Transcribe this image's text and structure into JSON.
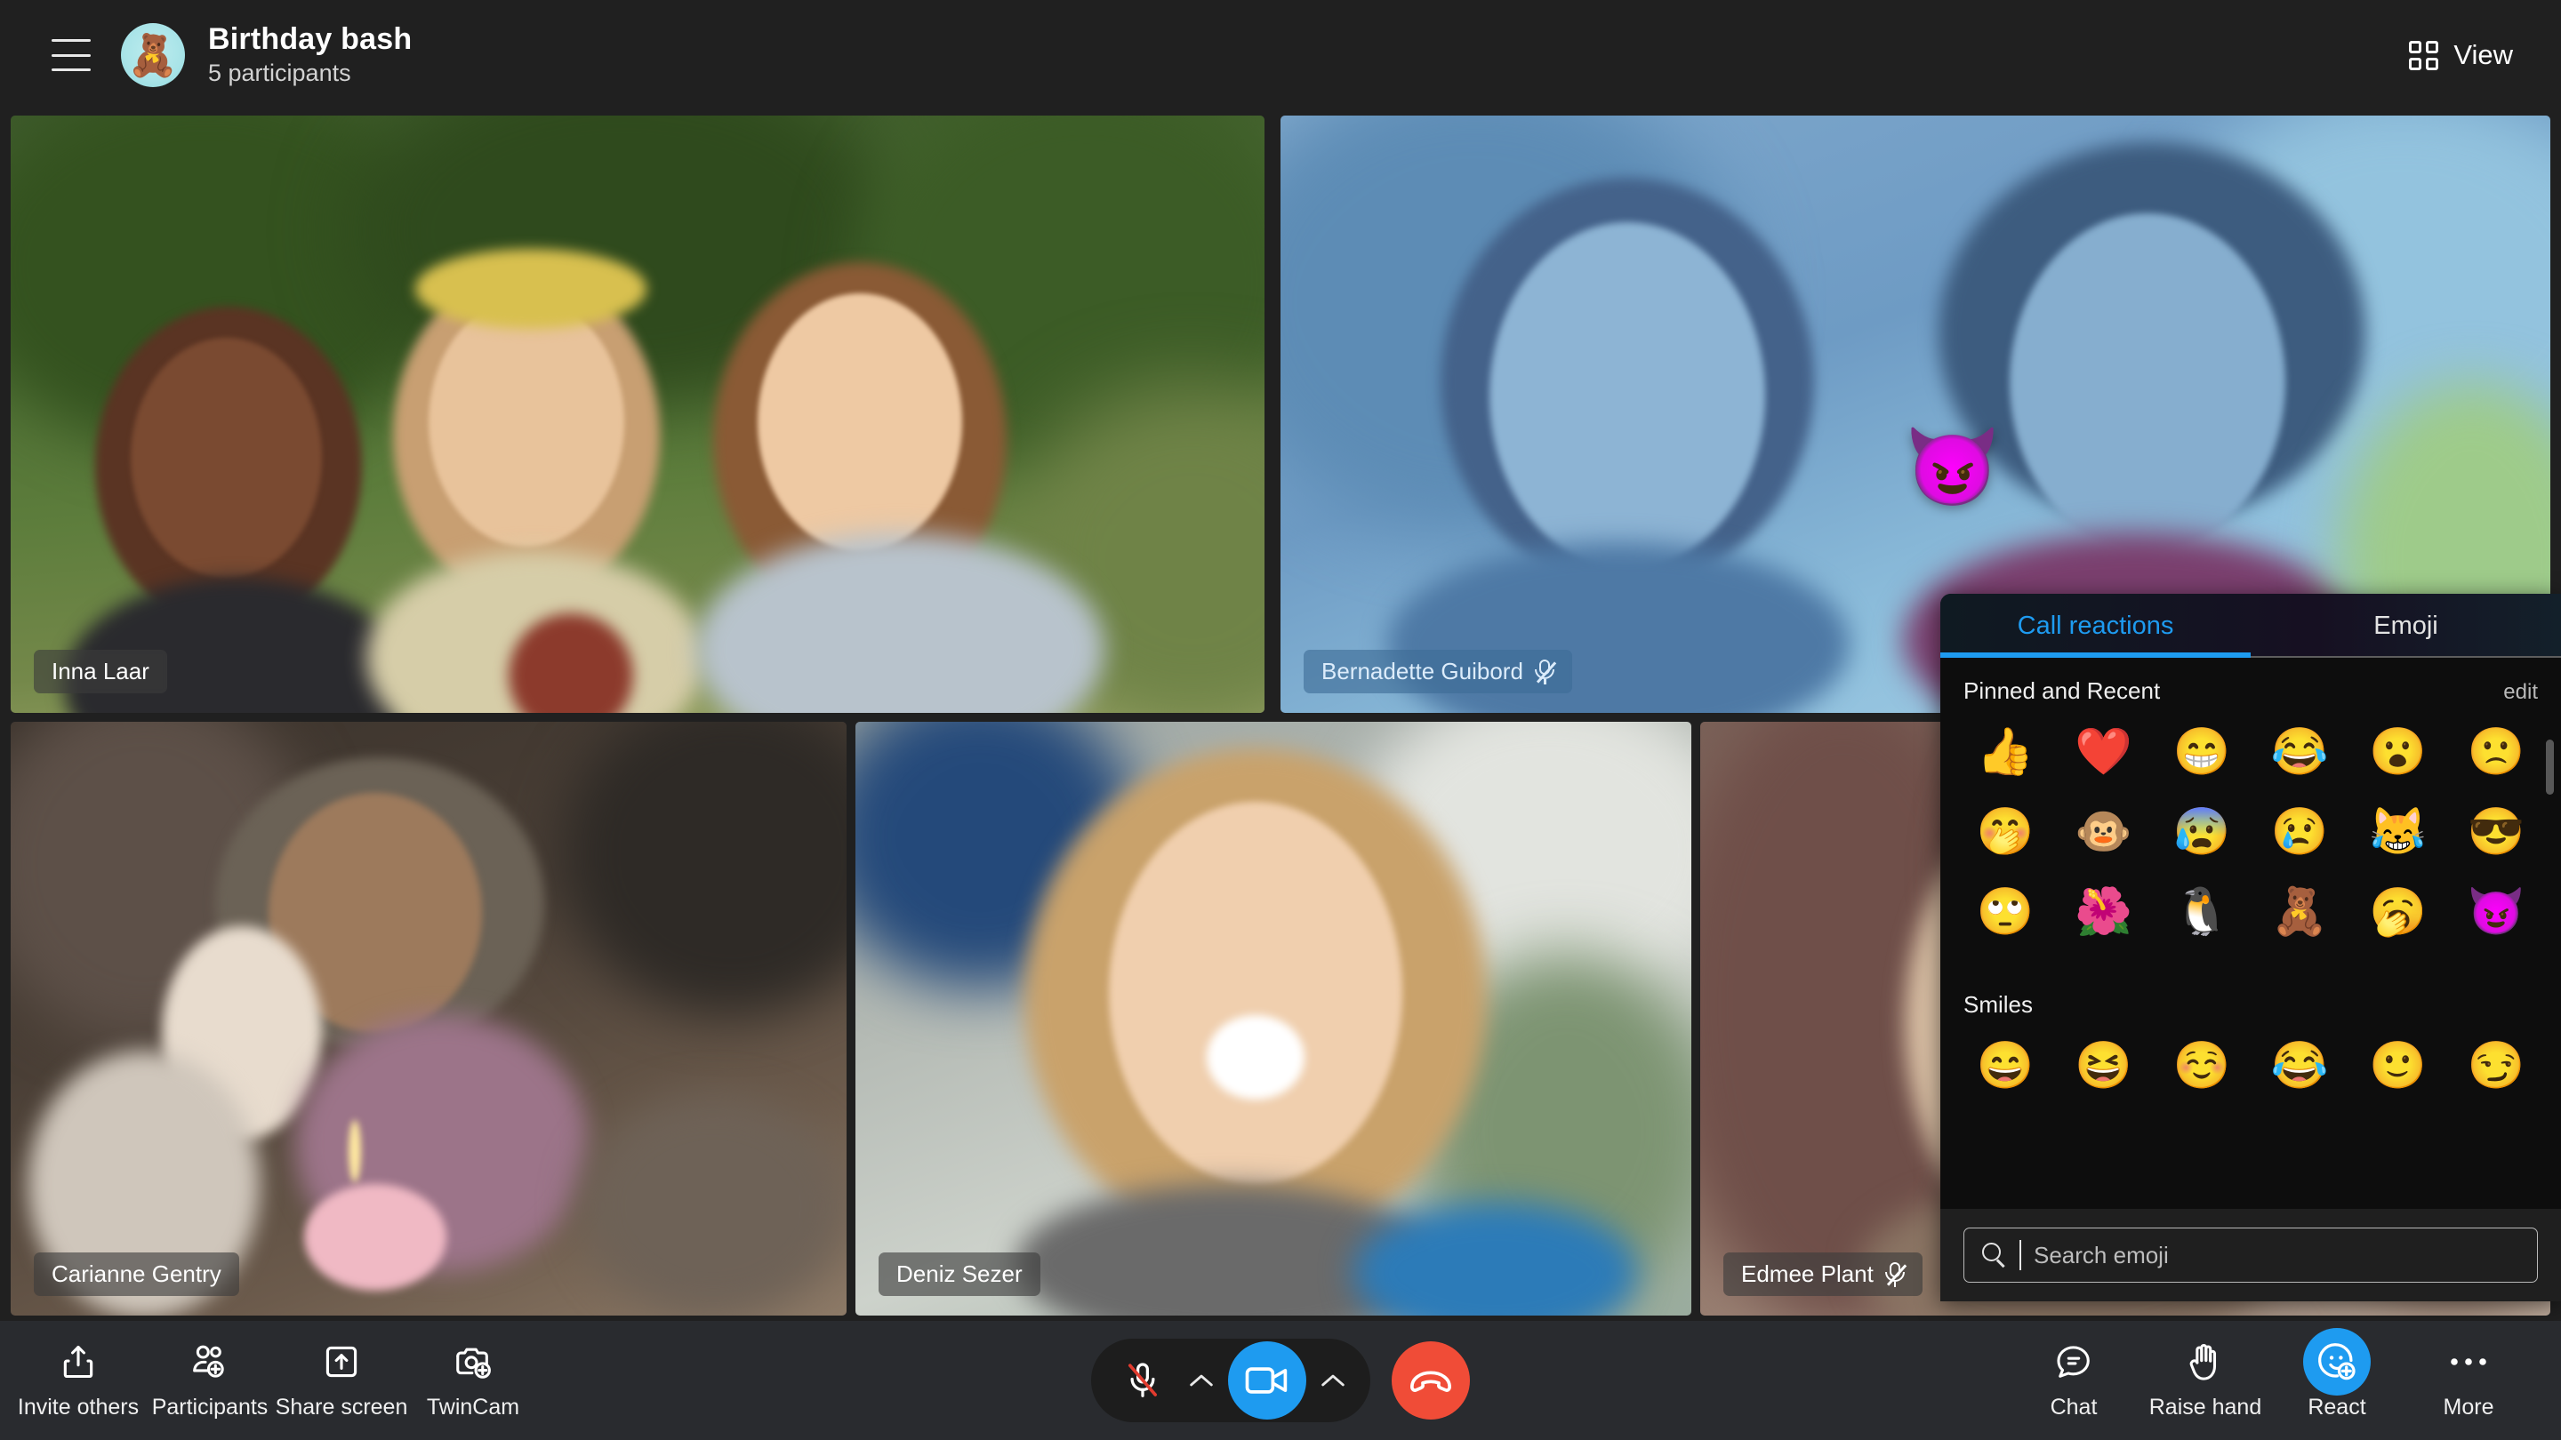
{
  "header": {
    "menu_icon": "hamburger-menu-icon",
    "avatar_emoji": "🧸",
    "title": "Birthday bash",
    "subtitle": "5 participants",
    "view_label": "View",
    "view_icon": "grid-view-icon"
  },
  "colors": {
    "accent_blue": "#1e9bf0",
    "end_call_red": "#f04c37",
    "toolbar_bg": "#292b2f",
    "header_bg": "#202020",
    "panel_bg": "#0d0d0d",
    "mute_slash_red": "#e23b2e"
  },
  "tiles": [
    {
      "name": "Inna Laar",
      "muted": false,
      "tag_style": "dark"
    },
    {
      "name": "Bernadette Guibord",
      "muted": true,
      "tag_style": "blue"
    },
    {
      "name": "Carianne Gentry",
      "muted": false,
      "tag_style": "dark"
    },
    {
      "name": "Deniz Sezer",
      "muted": false,
      "tag_style": "dark"
    },
    {
      "name": "Edmee Plant",
      "muted": true,
      "tag_style": "dark"
    }
  ],
  "floating_reaction": {
    "emoji": "😈",
    "icon_name": "smiling-face-with-horns-reaction"
  },
  "react_panel": {
    "tabs": [
      {
        "label": "Call reactions",
        "active": true
      },
      {
        "label": "Emoji",
        "active": false
      }
    ],
    "sections": [
      {
        "title": "Pinned and Recent",
        "edit_label": "edit",
        "emojis": [
          {
            "glyph": "👍",
            "name": "thumbs-up-emoji"
          },
          {
            "glyph": "❤️",
            "name": "red-heart-emoji"
          },
          {
            "glyph": "😁",
            "name": "grinning-face-emoji"
          },
          {
            "glyph": "😂",
            "name": "face-with-tears-of-joy-emoji"
          },
          {
            "glyph": "😮",
            "name": "surprised-face-emoji"
          },
          {
            "glyph": "🙁",
            "name": "slightly-frowning-face-emoji"
          },
          {
            "glyph": "🤭",
            "name": "face-with-hand-over-mouth-emoji"
          },
          {
            "glyph": "🐵",
            "name": "monkey-emoji"
          },
          {
            "glyph": "😰",
            "name": "anxious-face-with-sweat-emoji"
          },
          {
            "glyph": "😢",
            "name": "crying-face-emoji"
          },
          {
            "glyph": "😹",
            "name": "laughing-with-tears-emoji"
          },
          {
            "glyph": "😎",
            "name": "smiling-face-with-sunglasses-emoji"
          },
          {
            "glyph": "🙄",
            "name": "face-with-rolling-eyes-emoji"
          },
          {
            "glyph": "🌺",
            "name": "flower-emoji"
          },
          {
            "glyph": "🐧",
            "name": "penguin-emoji"
          },
          {
            "glyph": "🧸",
            "name": "teddy-bear-emoji"
          },
          {
            "glyph": "🥱",
            "name": "yawning-face-emoji"
          },
          {
            "glyph": "😈",
            "name": "smiling-face-with-horns-emoji"
          }
        ]
      },
      {
        "title": "Smiles",
        "edit_label": "",
        "emojis": [
          {
            "glyph": "😄",
            "name": "grinning-face-smiling-eyes-emoji"
          },
          {
            "glyph": "😆",
            "name": "laughing-squinting-face-emoji"
          },
          {
            "glyph": "☺️",
            "name": "blushing-smiling-face-emoji"
          },
          {
            "glyph": "😂",
            "name": "face-with-tears-of-joy-emoji"
          },
          {
            "glyph": "🙂",
            "name": "slightly-smiling-face-emoji"
          },
          {
            "glyph": "😏",
            "name": "smirking-face-emoji"
          }
        ]
      }
    ],
    "search_placeholder": "Search emoji",
    "search_value": ""
  },
  "toolbar": {
    "left": [
      {
        "label": "Invite others",
        "icon": "share-upload-icon"
      },
      {
        "label": "Participants",
        "icon": "people-add-icon"
      },
      {
        "label": "Share screen",
        "icon": "screen-share-icon"
      },
      {
        "label": "TwinCam",
        "icon": "camera-add-icon"
      }
    ],
    "center": {
      "mic_icon": "microphone-muted-icon",
      "mic_menu_icon": "chevron-up-icon",
      "camera_icon": "camera-on-icon",
      "camera_menu_icon": "chevron-up-icon",
      "end_call_icon": "end-call-icon"
    },
    "right": [
      {
        "label": "Chat",
        "icon": "chat-bubble-icon",
        "active": false
      },
      {
        "label": "Raise hand",
        "icon": "raised-hand-icon",
        "active": false
      },
      {
        "label": "React",
        "icon": "react-smiley-plus-icon",
        "active": true
      },
      {
        "label": "More",
        "icon": "more-horizontal-icon",
        "active": false
      }
    ]
  }
}
